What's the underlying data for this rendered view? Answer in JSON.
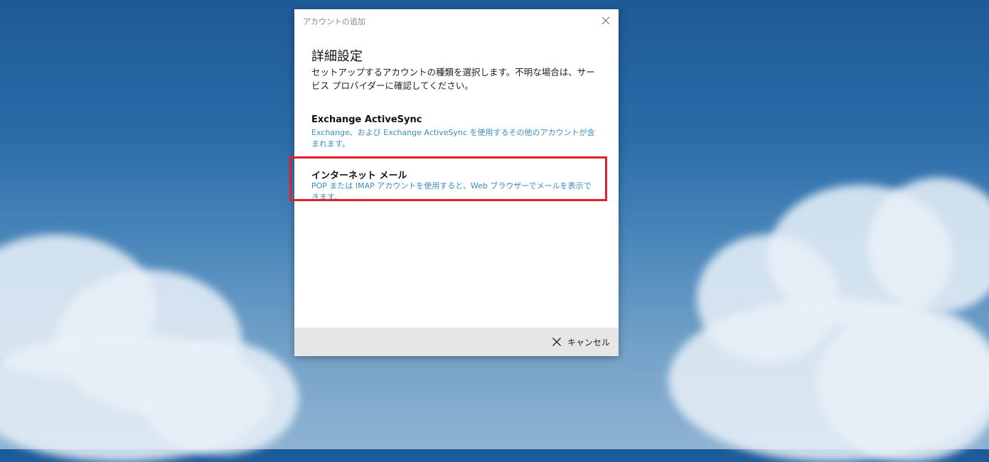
{
  "dialog": {
    "title": "アカウントの追加",
    "heading": "詳細設定",
    "description": "セットアップするアカウントの種類を選択します。不明な場合は、サービス プロバイダーに確認してください。",
    "options": [
      {
        "title": "Exchange ActiveSync",
        "description": "Exchange、および Exchange ActiveSync を使用するその他のアカウントが含まれます。"
      },
      {
        "title": "インターネット メール",
        "description": "POP または IMAP アカウントを使用すると、Web ブラウザーでメールを表示できます。"
      }
    ],
    "cancel_label": "キャンセル"
  },
  "colors": {
    "highlight": "#e0202a",
    "link_blue": "#3a8ec6",
    "footer": "#e6e6e6"
  }
}
